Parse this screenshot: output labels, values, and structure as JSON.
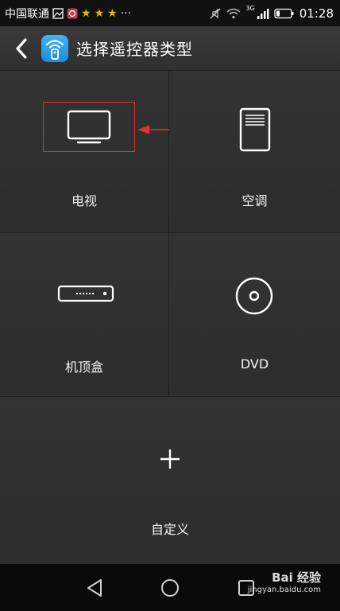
{
  "status_bar": {
    "carrier": "中国联通",
    "network": "3G",
    "time": "01:28"
  },
  "header": {
    "title": "选择遥控器类型",
    "back_icon": "chevron-left-icon",
    "logo_icon": "wifi-remote-icon"
  },
  "devices": [
    {
      "label": "电视",
      "icon": "tv-icon"
    },
    {
      "label": "空调",
      "icon": "air-conditioner-icon"
    },
    {
      "label": "机顶盒",
      "icon": "set-top-box-icon"
    },
    {
      "label": "DVD",
      "icon": "disc-icon"
    },
    {
      "label": "自定义",
      "icon": "plus-icon"
    }
  ],
  "annotation": {
    "highlight_color": "#e0342c"
  },
  "nav_bar": {
    "watermark_text": "Bai 经验",
    "watermark_domain": "jingyan.baidu.com"
  },
  "colors": {
    "background": "#2c2c2c",
    "status_bar": "#111111",
    "nav_bar": "#0a0a0a",
    "logo": "#2a9fee"
  }
}
